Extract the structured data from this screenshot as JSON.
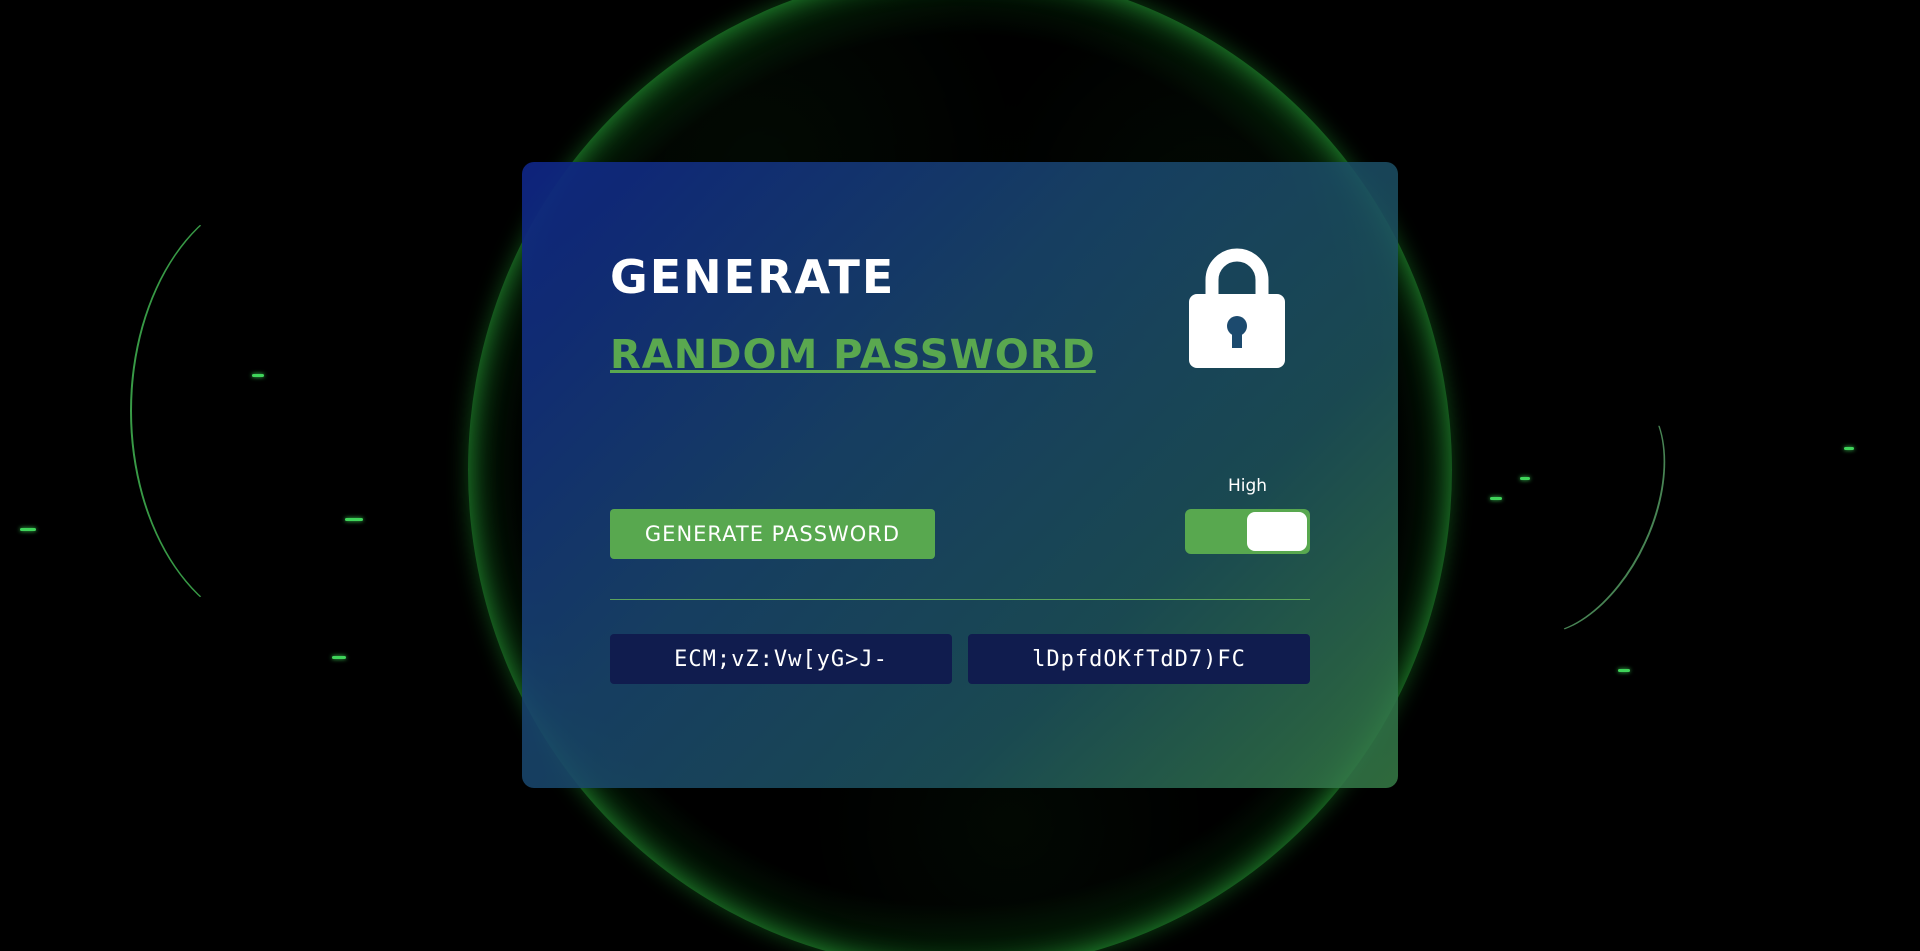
{
  "header": {
    "title_line1": "GENERATE",
    "title_line2": "RANDOM PASSWORD"
  },
  "icons": {
    "lock": "lock-icon"
  },
  "controls": {
    "generate_button_label": "GENERATE PASSWORD",
    "strength_label": "High",
    "strength_toggle_on": true
  },
  "passwords": [
    "ECM;vZ:Vw[yG>J-",
    "lDpfdOKfTdD7)FC"
  ],
  "colors": {
    "accent_green": "#58a84f",
    "password_box_bg": "#101c4e",
    "card_gradient_start": "#0e2482",
    "card_gradient_end": "#377d46"
  }
}
